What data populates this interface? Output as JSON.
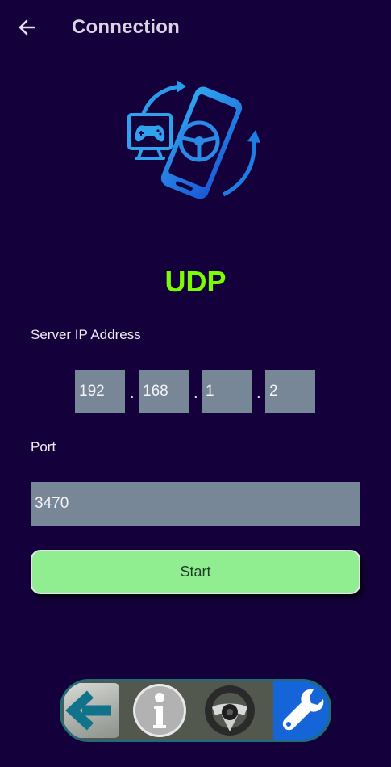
{
  "header": {
    "title": "Connection"
  },
  "hero": {
    "icon": "phone-steering-wheel-gamepad-sync-icon"
  },
  "connection": {
    "protocol": "UDP",
    "protocol_color": "#7cfc00"
  },
  "server_ip": {
    "label": "Server IP Address",
    "octets": [
      "192",
      "168",
      "1",
      "2"
    ],
    "separator": "."
  },
  "port": {
    "label": "Port",
    "value": "3470"
  },
  "start_button": {
    "label": "Start",
    "color": "#90ee90"
  },
  "bottom_nav": {
    "items": [
      {
        "icon": "back-arrow-icon"
      },
      {
        "icon": "info-icon"
      },
      {
        "icon": "steering-wheel-icon"
      },
      {
        "icon": "wrench-icon",
        "active": true
      }
    ],
    "active_color": "#1565d8"
  },
  "theme": {
    "background": "#14003a",
    "input_background": "#778797"
  }
}
